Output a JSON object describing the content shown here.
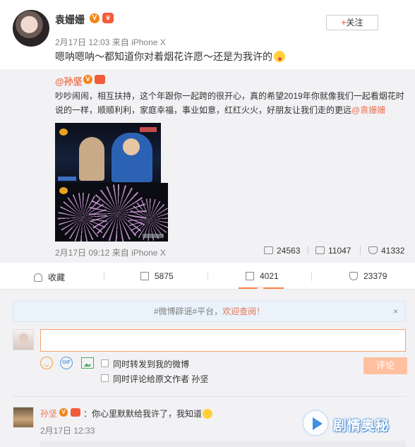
{
  "post": {
    "author": "袁姗姗",
    "timestamp": "2月17日 12:03",
    "source": "来自 iPhone X",
    "follow_label": "关注",
    "text": "嗯呐嗯呐～都知道你对着烟花许愿～还是为我许的"
  },
  "repost": {
    "author": "@孙坚",
    "text_main": "吵吵闹闹，相互扶持，这个年跟你一起跨的很开心，真的希望2019年你就像我们一起看烟花时说的一样，顺顺利利，家庭幸福，事业如意，红红火火，好朋友让我们走的更远",
    "mention": "@袁姗姗",
    "timestamp": "2月17日 09:12",
    "source": "来自 iPhone X",
    "forwards": "24563",
    "comments": "11047",
    "likes": "41332"
  },
  "actions": {
    "favorite": "收藏",
    "forward": "5875",
    "comment": "4021",
    "like": "23379"
  },
  "comment_area": {
    "notice_prefix": "#微博辟谣#平台，",
    "notice_highlight": "欢迎查阅！",
    "close": "×",
    "option_forward": "同时转发到我的微博",
    "option_comment_author": "同时评论给原文作者 孙坚",
    "submit_label": "评论"
  },
  "comment": {
    "author": "孙坚",
    "text": "：你心里默默给我许了，我知道",
    "time": "2月17日 12:33"
  },
  "watermark": {
    "text": "剧情奥秘"
  },
  "colors": {
    "accent": "#eb7350",
    "meta_gray": "#808080",
    "panel_bg": "#f2f2f5",
    "verified": "#f1871b"
  }
}
